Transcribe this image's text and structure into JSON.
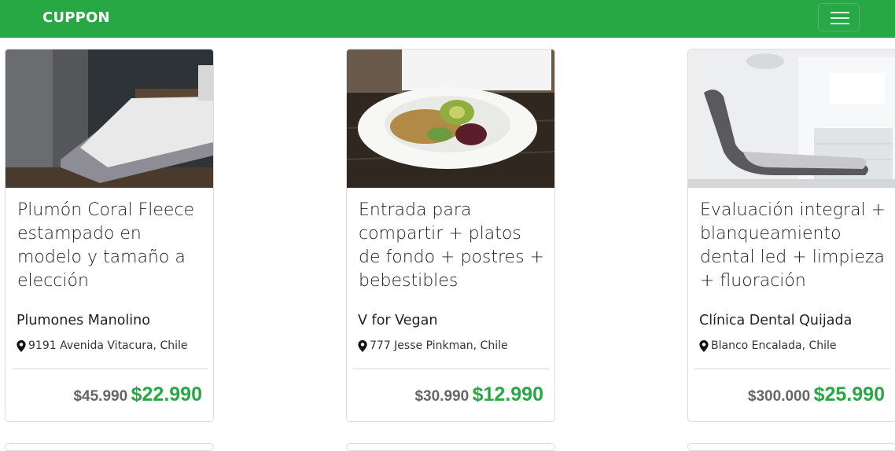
{
  "navbar": {
    "brand": "CUPPON",
    "menu_icon": "hamburger-menu-icon",
    "color": "#28a745"
  },
  "cards": [
    {
      "title": "Plumón Coral Fleece estampado en modelo y tamaño a elección",
      "merchant": "Plumones Manolino",
      "address": "9191 Avenida Vitacura, Chile",
      "old_price": "$45.990",
      "new_price": "$22.990"
    },
    {
      "title": "Entrada para compartir + platos de fondo + postres + bebestibles",
      "merchant": "V for Vegan",
      "address": "777 Jesse Pinkman, Chile",
      "old_price": "$30.990",
      "new_price": "$12.990"
    },
    {
      "title": "Evaluación integral + blanqueamiento dental led + limpieza + fluoración",
      "merchant": "Clínica Dental Quijada",
      "address": "Blanco Encalada, Chile",
      "old_price": "$300.000",
      "new_price": "$25.990"
    }
  ]
}
